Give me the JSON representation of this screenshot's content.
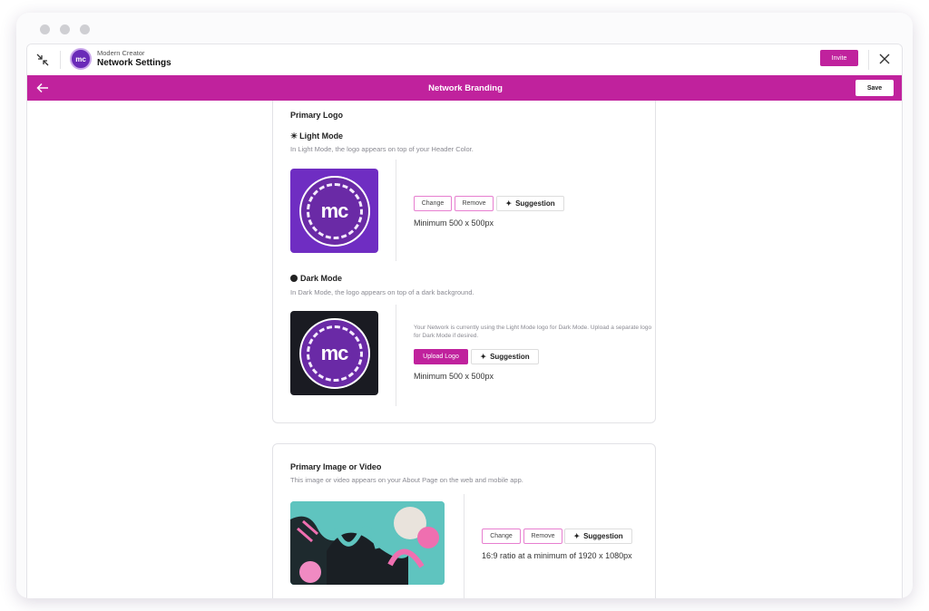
{
  "app": {
    "org_name": "Modern Creator",
    "title": "Network Settings",
    "avatar_text": "mc",
    "invite_label": "Invite"
  },
  "page_bar": {
    "title": "Network Branding",
    "save_label": "Save"
  },
  "primary_logo": {
    "heading": "Primary Logo",
    "light_mode": {
      "title": "Light Mode",
      "description": "In Light Mode, the logo appears on top of your Header Color.",
      "logo_text": "mc",
      "change_label": "Change",
      "remove_label": "Remove",
      "suggestion_label": "Suggestion",
      "requirement": "Minimum 500 x 500px"
    },
    "dark_mode": {
      "title": "Dark Mode",
      "description": "In Dark Mode, the logo appears on top of a dark background.",
      "logo_text": "mc",
      "note": "Your Network is currently using the Light Mode logo for Dark Mode. Upload a separate logo for Dark Mode if desired.",
      "upload_label": "Upload Logo",
      "suggestion_label": "Suggestion",
      "requirement": "Minimum 500 x 500px"
    }
  },
  "primary_media": {
    "heading": "Primary Image or Video",
    "description": "This image or video appears on your About Page on the web and mobile app.",
    "change_label": "Change",
    "remove_label": "Remove",
    "suggestion_label": "Suggestion",
    "requirement": "16:9 ratio at a minimum of 1920 x 1080px"
  },
  "colors": {
    "accent": "#c0229d",
    "logo_purple": "#6f2dc2",
    "logo_dark": "#1a1b22"
  }
}
